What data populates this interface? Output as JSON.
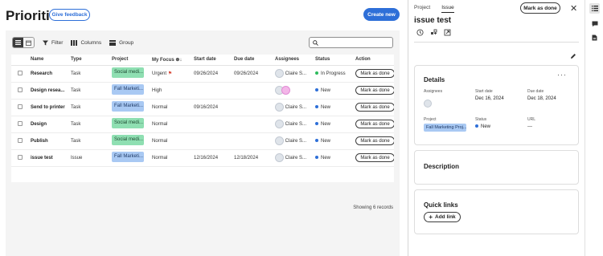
{
  "header": {
    "title": "Priorities",
    "feedback_label": "Give feedback",
    "create_label": "Create new"
  },
  "toolbar": {
    "filter_label": "Filter",
    "columns_label": "Columns",
    "group_label": "Group",
    "search_placeholder": ""
  },
  "table": {
    "columns": [
      "Name",
      "Type",
      "Project",
      "My Focus",
      "Start date",
      "Due date",
      "Assignees",
      "Status",
      "Action"
    ],
    "rows": [
      {
        "name": "Research",
        "type": "Task",
        "project": "Social medi...",
        "project_kind": "social",
        "focus": "Urgent",
        "start": "09/26/2024",
        "due": "09/26/2024",
        "assignee": "Claire S...",
        "status": "In Progress",
        "status_color": "green",
        "action": "Mark as done"
      },
      {
        "name": "Design resea...",
        "type": "Task",
        "project": "Fall Marketi...",
        "project_kind": "fall",
        "focus": "High",
        "start": "",
        "due": "",
        "assignee": "",
        "status": "New",
        "status_color": "blue",
        "action": "Mark as done"
      },
      {
        "name": "Send to printer",
        "type": "Task",
        "project": "Fall Marketi...",
        "project_kind": "fall",
        "focus": "Normal",
        "start": "09/16/2024",
        "due": "",
        "assignee": "Claire S...",
        "status": "New",
        "status_color": "blue",
        "action": "Mark as done"
      },
      {
        "name": "Design",
        "type": "Task",
        "project": "Social medi...",
        "project_kind": "social",
        "focus": "Normal",
        "start": "",
        "due": "",
        "assignee": "Claire S...",
        "status": "New",
        "status_color": "blue",
        "action": "Mark as done"
      },
      {
        "name": "Publish",
        "type": "Task",
        "project": "Social medi...",
        "project_kind": "social",
        "focus": "Normal",
        "start": "",
        "due": "",
        "assignee": "Claire S...",
        "status": "New",
        "status_color": "blue",
        "action": "Mark as done"
      },
      {
        "name": "issue test",
        "type": "Issue",
        "project": "Fall Marketi...",
        "project_kind": "fall",
        "focus": "Normal",
        "start": "12/16/2024",
        "due": "12/18/2024",
        "assignee": "Claire S...",
        "status": "New",
        "status_color": "blue",
        "action": "Mark as done"
      }
    ],
    "records_label": "Showing 6 records"
  },
  "drawer": {
    "tabs": [
      "Project",
      "Issue"
    ],
    "active_tab": "Issue",
    "mark_done_label": "Mark as done",
    "title": "issue test",
    "details": {
      "heading": "Details",
      "assignees_label": "Assignees",
      "start_label": "Start date",
      "start_value": "Dec 16, 2024",
      "due_label": "Due date",
      "due_value": "Dec 18, 2024",
      "project_label": "Project",
      "project_value": "Fall Marketing Proj...",
      "status_label": "Status",
      "status_value": "New",
      "url_label": "URL",
      "url_value": "---"
    },
    "description_heading": "Description",
    "quicklinks_heading": "Quick links",
    "add_link_label": "Add link"
  },
  "colors": {
    "accent": "#2e6fd8",
    "social_tag": "#8fdfb2",
    "fall_tag": "#a9c9f3",
    "in_progress": "#2dbb5d",
    "new": "#2e6fd8"
  }
}
